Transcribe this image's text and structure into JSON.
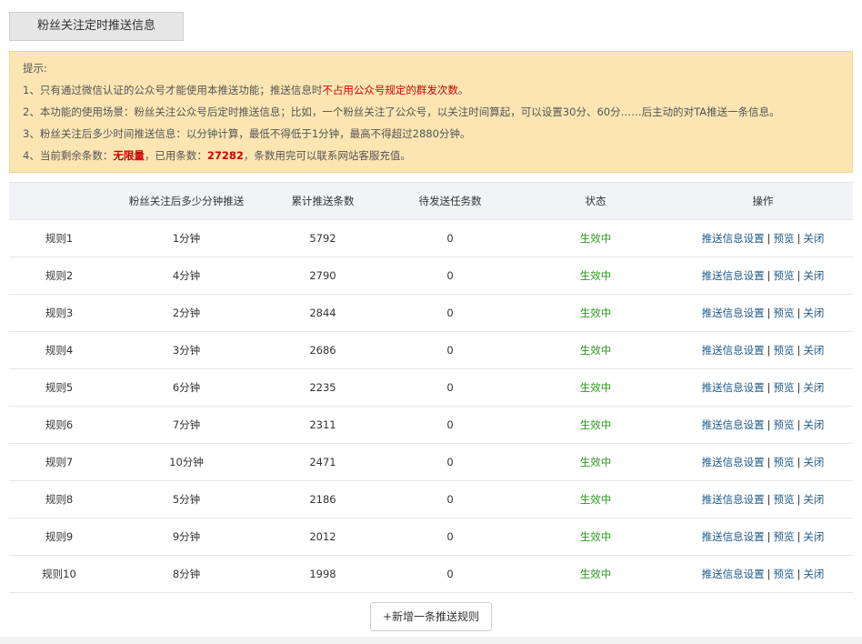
{
  "tab": {
    "label": "粉丝关注定时推送信息"
  },
  "notice": {
    "title": "提示:",
    "line1_pre": "1、只有通过微信认证的公众号才能使用本推送功能；推送信息时",
    "line1_red": "不占用公众号规定的群发次数",
    "line1_post": "。",
    "line2": "2、本功能的使用场景：粉丝关注公众号后定时推送信息；比如，一个粉丝关注了公众号，以关注时间算起，可以设置30分、60分……后主动的对TA推送一条信息。",
    "line3": "3、粉丝关注后多少时间推送信息：以分钟计算，最低不得低于1分钟，最高不得超过2880分钟。",
    "line4_pre": "4、当前剩余条数：",
    "line4_remaining": "无限量",
    "line4_mid": "，已用条数：",
    "line4_used": "27282",
    "line4_post": "，条数用完可以联系网站客服充值。"
  },
  "table": {
    "headers": [
      "",
      "粉丝关注后多少分钟推送",
      "累计推送条数",
      "待发送任务数",
      "状态",
      "操作"
    ],
    "rows": [
      {
        "name": "规则1",
        "minutes": "1分钟",
        "total": "5792",
        "pending": "0",
        "status": "生效中"
      },
      {
        "name": "规则2",
        "minutes": "4分钟",
        "total": "2790",
        "pending": "0",
        "status": "生效中"
      },
      {
        "name": "规则3",
        "minutes": "2分钟",
        "total": "2844",
        "pending": "0",
        "status": "生效中"
      },
      {
        "name": "规则4",
        "minutes": "3分钟",
        "total": "2686",
        "pending": "0",
        "status": "生效中"
      },
      {
        "name": "规则5",
        "minutes": "6分钟",
        "total": "2235",
        "pending": "0",
        "status": "生效中"
      },
      {
        "name": "规则6",
        "minutes": "7分钟",
        "total": "2311",
        "pending": "0",
        "status": "生效中"
      },
      {
        "name": "规则7",
        "minutes": "10分钟",
        "total": "2471",
        "pending": "0",
        "status": "生效中"
      },
      {
        "name": "规则8",
        "minutes": "5分钟",
        "total": "2186",
        "pending": "0",
        "status": "生效中"
      },
      {
        "name": "规则9",
        "minutes": "9分钟",
        "total": "2012",
        "pending": "0",
        "status": "生效中"
      },
      {
        "name": "规则10",
        "minutes": "8分钟",
        "total": "1998",
        "pending": "0",
        "status": "生效中"
      }
    ],
    "actions": {
      "settings": "推送信息设置",
      "preview": "预览",
      "close": "关闭",
      "separator": "|"
    }
  },
  "add_button": {
    "label": "+新增一条推送规则"
  },
  "colors": {
    "notice_bg": "#fbe6b3",
    "status_green": "#2a9a1a",
    "link_blue": "#1e5a8a",
    "red": "#d00000"
  }
}
